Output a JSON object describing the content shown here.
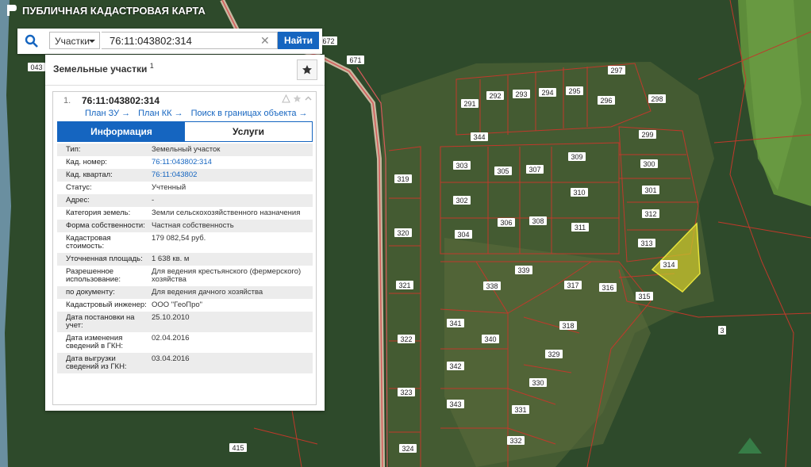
{
  "header": {
    "title": "ПУБЛИЧНАЯ КАДАСТРОВАЯ КАРТА"
  },
  "search": {
    "type_label": "Участки",
    "query": "76:11:043802:314",
    "button": "Найти"
  },
  "panel": {
    "title": "Земельные участки",
    "title_sup": "1",
    "item_number": "1.",
    "cad_number": "76:11:043802:314",
    "links": [
      "План ЗУ →",
      "План КК →",
      "Поиск в границах объекта →"
    ],
    "tabs": [
      "Информация",
      "Услуги"
    ],
    "rows": [
      {
        "k": "Тип:",
        "v": "Земельный участок"
      },
      {
        "k": "Кад. номер:",
        "v": "76:11:043802:314",
        "link": true
      },
      {
        "k": "Кад. квартал:",
        "v": "76:11:043802",
        "link": true
      },
      {
        "k": "Статус:",
        "v": "Учтенный"
      },
      {
        "k": "Адрес:",
        "v": "-"
      },
      {
        "k": "Категория земель:",
        "v": "Земли сельскохозяйственного назначения"
      },
      {
        "k": "Форма собственности:",
        "v": "Частная собственность"
      },
      {
        "k": "Кадастровая стоимость:",
        "v": "179 082,54 руб."
      },
      {
        "k": "Уточненная площадь:",
        "v": "1 638 кв. м"
      },
      {
        "k": "Разрешенное использование:",
        "v": "Для ведения крестьянского (фермерского) хозяйства"
      },
      {
        "k": "по документу:",
        "v": "Для ведения дачного хозяйства"
      },
      {
        "k": "Кадастровый инженер:",
        "v": "ООО \"ГеоПро\""
      },
      {
        "k": "Дата постановки на учет:",
        "v": "25.10.2010"
      },
      {
        "k": "Дата изменения сведений в ГКН:",
        "v": "02.04.2016"
      },
      {
        "k": "Дата выгрузки сведений из ГКН:",
        "v": "03.04.2016"
      }
    ]
  },
  "map": {
    "labels": [
      "043",
      "671",
      "672",
      "297",
      "296",
      "298",
      "294",
      "295",
      "292",
      "293",
      "291",
      "344",
      "299",
      "300",
      "301",
      "302",
      "303",
      "304",
      "305",
      "306",
      "307",
      "308",
      "309",
      "310",
      "311",
      "312",
      "313",
      "314",
      "315",
      "316",
      "317",
      "318",
      "319",
      "320",
      "321",
      "322",
      "323",
      "324",
      "329",
      "330",
      "331",
      "332",
      "338",
      "339",
      "340",
      "341",
      "342",
      "343",
      "3",
      "415"
    ]
  },
  "colors": {
    "accent": "#1565c0",
    "parcel_line": "#c0392b",
    "highlight": "#c9c42c"
  }
}
